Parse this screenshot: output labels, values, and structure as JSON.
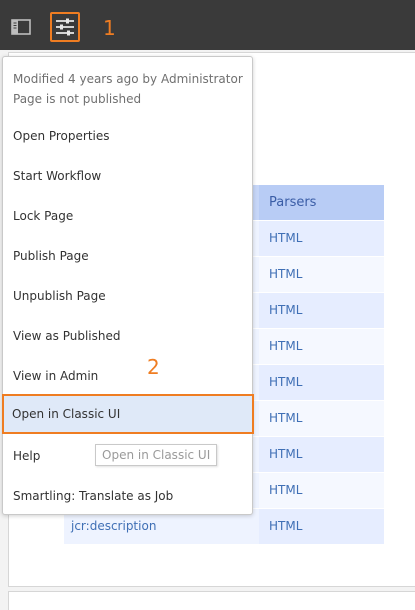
{
  "toolbar": {
    "panel_icon": "sidebar-panel-icon",
    "settings_icon": "sliders-settings-icon",
    "step_1": "1"
  },
  "table": {
    "header": {
      "col2": "Parsers"
    },
    "rows": [
      {
        "col1": "",
        "col2": "HTML"
      },
      {
        "col1": "",
        "col2": "HTML"
      },
      {
        "col1": "",
        "col2": "HTML"
      },
      {
        "col1": "",
        "col2": "HTML"
      },
      {
        "col1": "",
        "col2": "HTML"
      },
      {
        "col1": "",
        "col2": "HTML"
      },
      {
        "col1": "",
        "col2": "HTML"
      },
      {
        "col1": "",
        "col2": "HTML"
      },
      {
        "col1": "jcr:description",
        "col2": "HTML"
      }
    ]
  },
  "menu": {
    "modified": "Modified 4 years ago by Administrator",
    "status": "Page is not published",
    "items": [
      {
        "label": "Open Properties"
      },
      {
        "label": "Start Workflow"
      },
      {
        "label": "Lock Page"
      },
      {
        "label": "Publish Page"
      },
      {
        "label": "Unpublish Page"
      },
      {
        "label": "View as Published"
      },
      {
        "label": "View in Admin"
      },
      {
        "label": "Open in Classic UI"
      },
      {
        "label": "Help"
      },
      {
        "label": "Smartling: Translate as Job"
      }
    ],
    "step_2": "2",
    "tooltip": "Open in Classic UI"
  },
  "colors": {
    "accent": "#ef7d22",
    "toolbar": "#3a3a3a",
    "highlight": "#dfe9f8",
    "link": "#3f6fb5"
  }
}
